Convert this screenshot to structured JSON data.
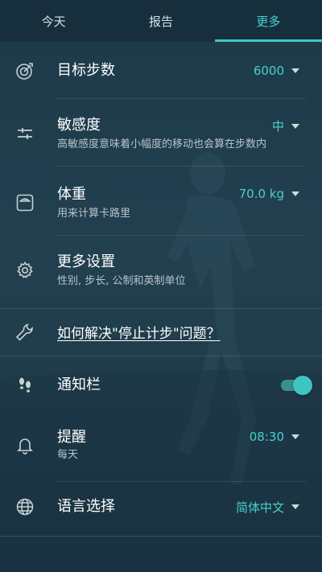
{
  "tabs": [
    {
      "label": "今天"
    },
    {
      "label": "报告"
    },
    {
      "label": "更多"
    }
  ],
  "settings": {
    "goal": {
      "title": "目标步数",
      "value": "6000",
      "icon": "target-icon"
    },
    "sensitivity": {
      "title": "敏感度",
      "subtitle": "高敏感度意味着小幅度的移动也会算在步数内",
      "value": "中",
      "icon": "sliders-icon"
    },
    "weight": {
      "title": "体重",
      "subtitle": "用来计算卡路里",
      "value": "70.0 kg",
      "icon": "scale-icon"
    },
    "more": {
      "title": "更多设置",
      "subtitle": "性别, 步长, 公制和英制单位",
      "icon": "gear-icon"
    },
    "help": {
      "title": "如何解决\"停止计步\"问题？",
      "icon": "wrench-icon"
    },
    "notification": {
      "title": "通知栏",
      "enabled": true,
      "icon": "footprints-icon"
    },
    "reminder": {
      "title": "提醒",
      "subtitle": "每天",
      "value": "08:30",
      "icon": "bell-icon"
    },
    "language": {
      "title": "语言选择",
      "value": "简体中文",
      "icon": "globe-icon"
    }
  },
  "colors": {
    "accent": "#49d0cd",
    "background": "#1f3b49"
  }
}
